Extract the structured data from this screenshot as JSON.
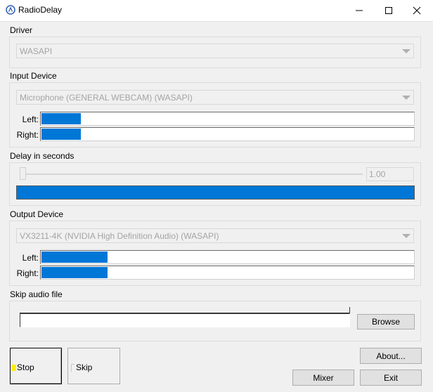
{
  "window": {
    "title": "RadioDelay",
    "controls": [
      "minimize-icon",
      "maximize-icon",
      "close-icon"
    ]
  },
  "driver": {
    "label": "Driver",
    "selected": "WASAPI"
  },
  "input_device": {
    "label": "Input Device",
    "selected": "Microphone (GENERAL WEBCAM) (WASAPI)",
    "left_label": "Left:",
    "right_label": "Right:",
    "left_level": 0.11,
    "right_level": 0.11
  },
  "delay": {
    "label": "Delay in seconds",
    "value": "1.00",
    "slider_level": 0.0,
    "buffer_level": 1.0
  },
  "output_device": {
    "label": "Output Device",
    "selected": "VX3211-4K (NVIDIA High Definition Audio) (WASAPI)",
    "left_label": "Left:",
    "right_label": "Right:",
    "left_level": 0.18,
    "right_level": 0.18
  },
  "skip_file": {
    "label": "Skip audio file",
    "value": "",
    "browse_label": "Browse"
  },
  "buttons": {
    "stop_label": "Stop",
    "skip_label": "Skip",
    "about_label": "About...",
    "mixer_label": "Mixer",
    "exit_label": "Exit"
  },
  "colors": {
    "meter_fill": "#0077d7",
    "stop_indicator": "#ffee00"
  }
}
